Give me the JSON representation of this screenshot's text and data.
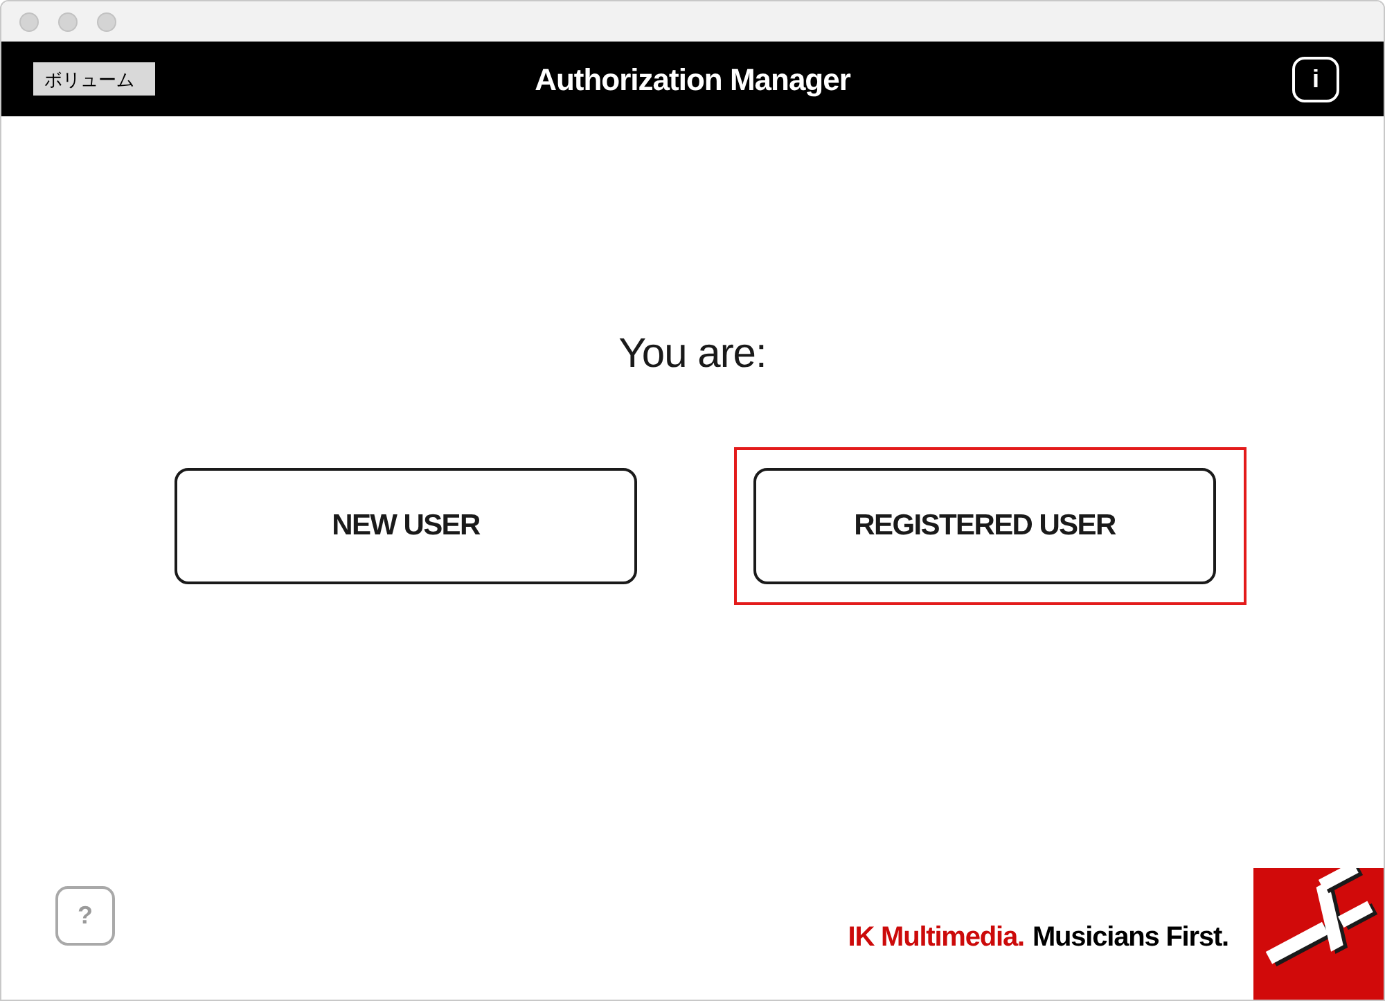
{
  "header": {
    "volume_button": "ボリューム",
    "title": "Authorization Manager",
    "info_button": "i"
  },
  "prompt": "You are:",
  "choices": [
    {
      "label": "NEW USER",
      "highlighted": false
    },
    {
      "label": "REGISTERED USER",
      "highlighted": true
    }
  ],
  "help_button": "?",
  "footer": {
    "brand": "IK Multimedia.",
    "slogan": "Musicians First."
  }
}
